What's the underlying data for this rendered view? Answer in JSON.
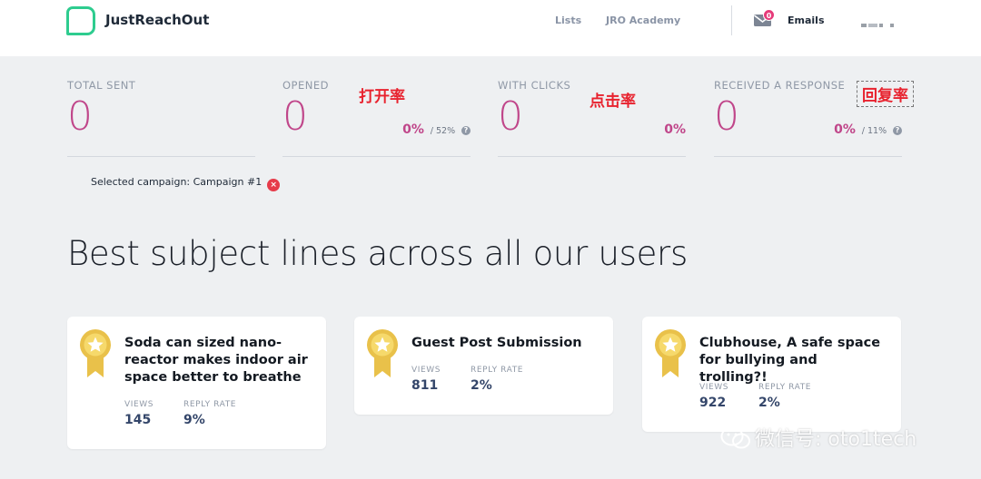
{
  "header": {
    "brand": "JustReachOut",
    "nav": {
      "lists": "Lists",
      "academy": "JRO Academy",
      "emails": "Emails"
    },
    "mail_badge": "0"
  },
  "stats": [
    {
      "label": "TOTAL SENT",
      "value": "0",
      "pct": "",
      "avg": ""
    },
    {
      "label": "OPENED",
      "value": "0",
      "pct": "0%",
      "avg": "/ 52%"
    },
    {
      "label": "WITH CLICKS",
      "value": "0",
      "pct": "0%",
      "avg": ""
    },
    {
      "label": "RECEIVED A RESPONSE",
      "value": "0",
      "pct": "0%",
      "avg": "/ 11%"
    }
  ],
  "annotations": {
    "open_rate": "打开率",
    "click_rate": "点击率",
    "reply_rate": "回复率"
  },
  "campaign": {
    "text": "Selected campaign: Campaign #1",
    "close": "×"
  },
  "section_title": "Best subject lines across all our users",
  "cards": [
    {
      "title": "Soda can sized nano-reactor makes indoor air space better to breathe",
      "views_label": "VIEWS",
      "views": "145",
      "reply_label": "REPLY RATE",
      "reply": "9%"
    },
    {
      "title": "Guest Post Submission",
      "views_label": "VIEWS",
      "views": "811",
      "reply_label": "REPLY RATE",
      "reply": "2%"
    },
    {
      "title": "Clubhouse, A safe space for bullying and trolling?!",
      "views_label": "VIEWS",
      "views": "922",
      "reply_label": "REPLY RATE",
      "reply": "2%"
    }
  ],
  "watermark": "微信号: oto1tech",
  "colors": {
    "accent": "#c0468a",
    "brand_green": "#2ecc8f",
    "badge": "#e63b7a",
    "annotation": "#e8222e"
  }
}
